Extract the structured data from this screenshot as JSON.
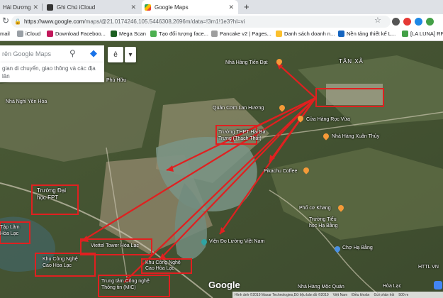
{
  "browser": {
    "tabs": [
      {
        "title": "Hải Dương",
        "active": false
      },
      {
        "title": "Ghi Chú iCloud",
        "active": false
      },
      {
        "title": "Google Maps",
        "active": true
      }
    ],
    "new_tab": "+",
    "url_host": "https://www.google.com",
    "url_rest": "/maps/@21.0174246,105.5446308,2696m/data=!3m1!1e3?hl=vi",
    "bookmarks": [
      {
        "label": "mail",
        "color": "#d93025"
      },
      {
        "label": "iCloud",
        "color": "#9aa0a6"
      },
      {
        "label": "Download Faceboo...",
        "color": "#c2185b"
      },
      {
        "label": "Mega Scan",
        "color": "#1b5e20"
      },
      {
        "label": "Tạo đối tượng face...",
        "color": "#4caf50"
      },
      {
        "label": "Pancake v2 | Pages...",
        "color": "#9e9e9e"
      },
      {
        "label": "Danh sách doanh n...",
        "color": "#fbc02d"
      },
      {
        "label": "Nền tảng thiết kế L...",
        "color": "#1565c0"
      },
      {
        "label": "[LA LUNA] RP -",
        "color": "#43a047"
      }
    ]
  },
  "maps": {
    "search_placeholder": "rên Google Maps",
    "search_hint": "gian di chuyển, giao thông và các địa\nlân",
    "layer_button": "ê",
    "dropdown_icon": "▾",
    "google_logo": "Google",
    "footer": [
      "Hình ảnh ©2019 Maxar Technologies,Dữ liệu bản đồ ©2019",
      "Việt Nam",
      "Điều khoản",
      "Gửi phản hồi",
      "500 m"
    ],
    "labels": [
      {
        "text": "Nhà Hàng Tiến Đạt",
        "pin": "orange"
      },
      {
        "text": "TÂN XÃ",
        "pin": ""
      },
      {
        "text": "Phú Hữu",
        "pin": ""
      },
      {
        "text": "Nhà Nghỉ Yên Hòa",
        "pin": "gray"
      },
      {
        "text": "Quán Cơm Lan Hương",
        "pin": "orange"
      },
      {
        "text": "Cửa Hàng Rọc Vừa",
        "pin": "orange"
      },
      {
        "text": "Trường THPT Hai Bà\nTrưng (Thạch Thất)",
        "pin": "gray"
      },
      {
        "text": "Nhà Hàng Xuân Thủy",
        "pin": "orange"
      },
      {
        "text": "Pikachu Coffee",
        "pin": "orange"
      },
      {
        "text": "Trường Đại\nhọc FPT",
        "pin": "gray"
      },
      {
        "text": "Phố cơ Khang",
        "pin": "orange"
      },
      {
        "text": "Trường Tiểu\nhọc Hạ Bằng",
        "pin": "gray"
      },
      {
        "text": "Chợ Hạ Bằng",
        "pin": "blue"
      },
      {
        "text": "Tập Lâm\nHòa Lạc",
        "pin": "gray"
      },
      {
        "text": "Viettel Tower Hòa Lạc",
        "pin": "gray"
      },
      {
        "text": "Viện Đo Lường Việt Nam",
        "pin": "teal"
      },
      {
        "text": "Khu Công Nghệ\nCao Hòa Lạc",
        "pin": "gray"
      },
      {
        "text": "Khu Công Nghệ\nCao Hòa Lạc",
        "pin": "gray"
      },
      {
        "text": "Trung tâm Công nghệ\nThông tin (MIC)",
        "pin": "gray"
      },
      {
        "text": "HTTL VN",
        "pin": ""
      },
      {
        "text": "Nhà Hàng Mộc Quán",
        "pin": ""
      },
      {
        "text": "Hòa Lạc",
        "pin": ""
      }
    ]
  },
  "colors": {
    "annotation": "#e02020",
    "map_dark": "#3a4a2c",
    "map_light": "#8a8f6a",
    "water": "#6a8a7a"
  }
}
